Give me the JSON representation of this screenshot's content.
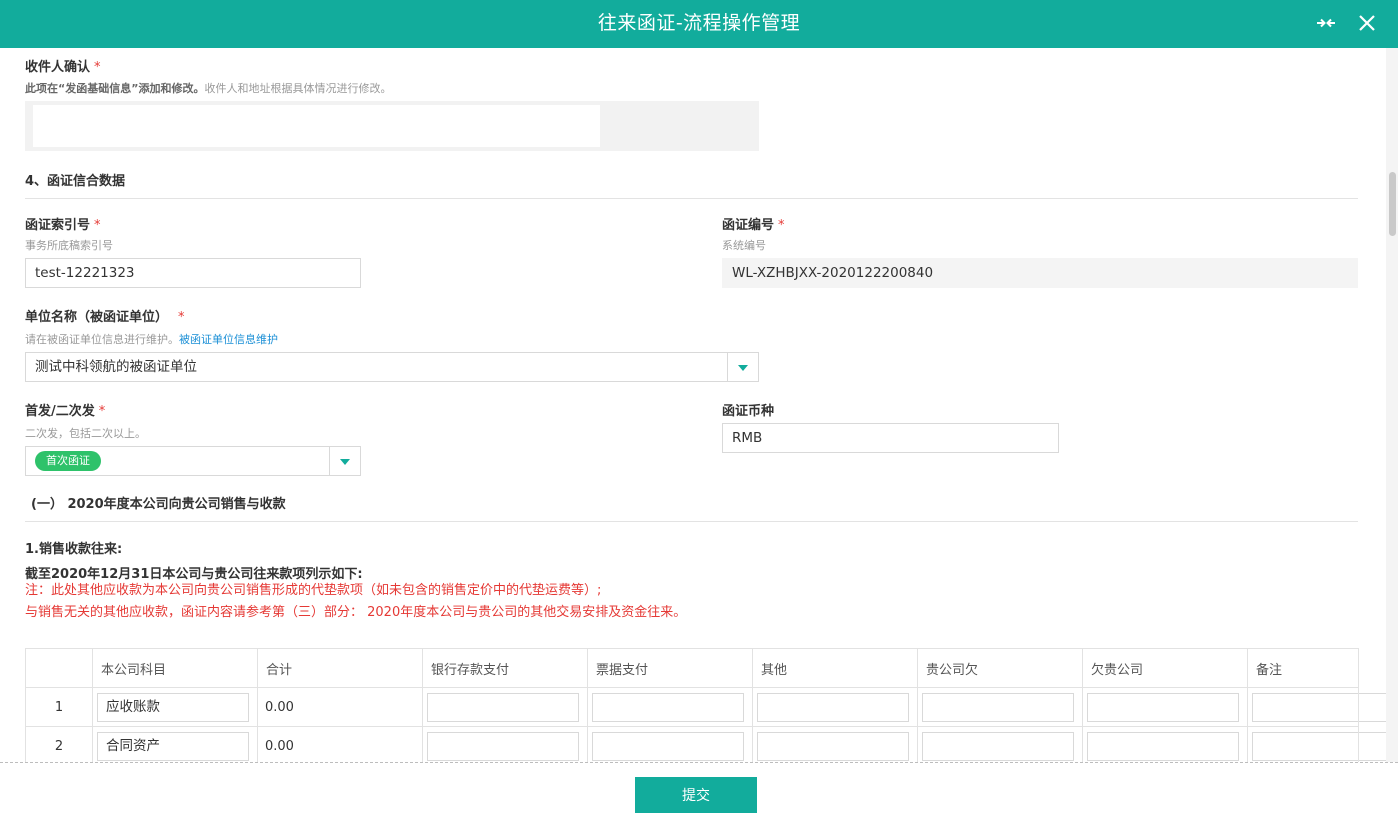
{
  "window": {
    "title": "往来函证-流程操作管理",
    "collapse_icon": "collapse-arrows-icon",
    "close_icon": "close-icon"
  },
  "recipient": {
    "label": "收件人确认",
    "required": "*",
    "hint_strong": "此项在“发函基础信息”添加和修改。",
    "hint": "收件人和地址根据具体情况进行修改。"
  },
  "section4": {
    "title": "4、函证信合数据"
  },
  "index_no": {
    "label": "函证索引号",
    "required": "*",
    "hint": "事务所底稿索引号",
    "value": "test-12221323"
  },
  "confirm_no": {
    "label": "函证编号",
    "required": "*",
    "hint": "系统编号",
    "value": "WL-XZHBJXX-2020122200840"
  },
  "unit": {
    "label": "单位名称（被函证单位）",
    "required": "*",
    "hint": "请在被函证单位信息进行维护。",
    "hint_link": "被函证单位信息维护",
    "value": "测试中科领航的被函证单位"
  },
  "send_type": {
    "label": "首发/二次发",
    "required": "*",
    "hint": "二次发，包括二次以上。",
    "tag": "首次函证"
  },
  "currency": {
    "label": "函证币种",
    "value": "RMB"
  },
  "subsection1": {
    "title": "(一） 2020年度本公司向贵公司销售与收款"
  },
  "sales": {
    "title": "1.销售收款往来:",
    "subtitle": "截至2020年12月31日本公司与贵公司往来款项列示如下:",
    "note1": "注：此处其他应收款为本公司向贵公司销售形成的代垫款项（如未包含的销售定价中的代垫运费等）;",
    "note2": "与销售无关的其他应收款，函证内容请参考第（三）部分： 2020年度本公司与贵公司的其他交易安排及资金往来。"
  },
  "table": {
    "headers": [
      "",
      "本公司科目",
      "合计",
      "银行存款支付",
      "票据支付",
      "其他",
      "贵公司欠",
      "欠贵公司",
      "备注"
    ],
    "rows": [
      {
        "no": "1",
        "subject": "应收账款",
        "total": "0.00"
      },
      {
        "no": "2",
        "subject": "合同资产",
        "total": "0.00"
      }
    ]
  },
  "footer": {
    "submit_label": "提交"
  },
  "colors": {
    "accent": "#12ac9c",
    "required": "#e53935",
    "tag": "#2ec26a",
    "link": "#1a8fd6"
  }
}
